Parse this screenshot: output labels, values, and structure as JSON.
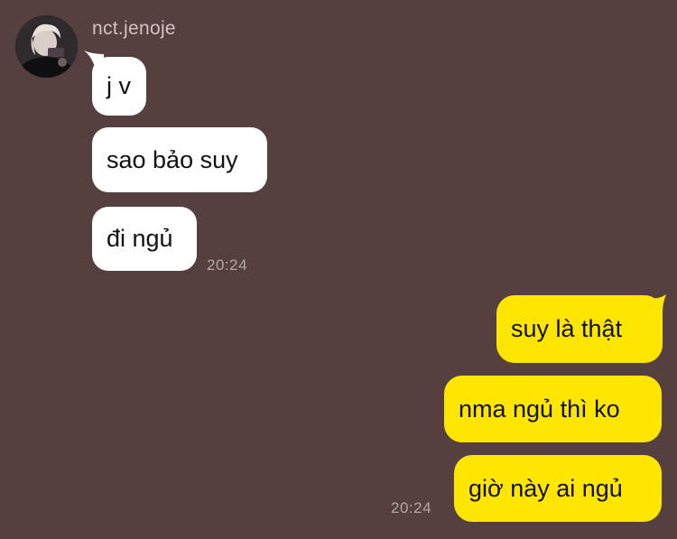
{
  "conversation": {
    "contact_name": "nct.jenoje",
    "incoming": [
      {
        "text": "j v"
      },
      {
        "text": "sao bảo suy"
      },
      {
        "text": "đi ngủ"
      }
    ],
    "incoming_time": "20:24",
    "outgoing": [
      {
        "text": "suy là thật"
      },
      {
        "text": "nma ngủ thì ko"
      },
      {
        "text": "giờ này ai ngủ"
      }
    ],
    "outgoing_time": "20:24"
  },
  "colors": {
    "background": "#553f3f",
    "incoming_bubble": "#ffffff",
    "outgoing_bubble": "#ffe600",
    "meta_text": "#b4a8a8"
  },
  "icons": {
    "avatar": "contact-avatar-photo"
  }
}
